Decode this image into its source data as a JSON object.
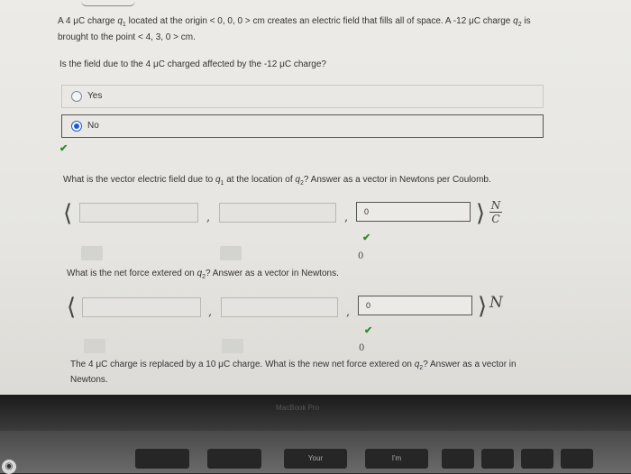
{
  "question": {
    "intro_part1": "A 4 μC charge ",
    "q1": "q",
    "q1_sub": "1",
    "intro_part2": " located at the origin < 0, 0, 0 > cm creates an electric field that fills all of space. A -12 μC charge ",
    "q2": "q",
    "q2_sub": "2",
    "intro_part3": " is brought to the point < 4, 3, 0 > cm.",
    "ask": "Is the field due to the 4 μC charged affected by the -12 μC charge?"
  },
  "options": [
    {
      "label": "Yes",
      "selected": false
    },
    {
      "label": "No",
      "selected": true
    }
  ],
  "check_mark": "✔",
  "part2": {
    "text_a": "What is the vector electric field due to ",
    "q": "q",
    "sub1": "1",
    "text_b": " at the location of ",
    "sub2": "2",
    "text_c": "? Answer as a vector in Newtons per Coulomb.",
    "values": [
      "",
      "",
      "0"
    ],
    "unit_num": "N",
    "unit_den": "C",
    "z_small": "0"
  },
  "part3": {
    "text_a": "What is the net force extered on ",
    "q": "q",
    "sub": "2",
    "text_b": "? Answer as a vector in Newtons.",
    "values": [
      "",
      "",
      "0"
    ],
    "unit": "N",
    "z_small": "0"
  },
  "part4": {
    "text_a": "The 4 μC charge is replaced by a 10 μC charge. What is the new net force extered on ",
    "q": "q",
    "sub": "2",
    "text_b": "? Answer as a vector in Newtons."
  },
  "symbols": {
    "langle": "⟨",
    "rangle": "⟩",
    "comma": ","
  },
  "bezel_label": "MacBook Pro",
  "keyboard": {
    "keys": [
      "",
      "",
      "Your",
      "I'm",
      "",
      "",
      "",
      ""
    ]
  }
}
